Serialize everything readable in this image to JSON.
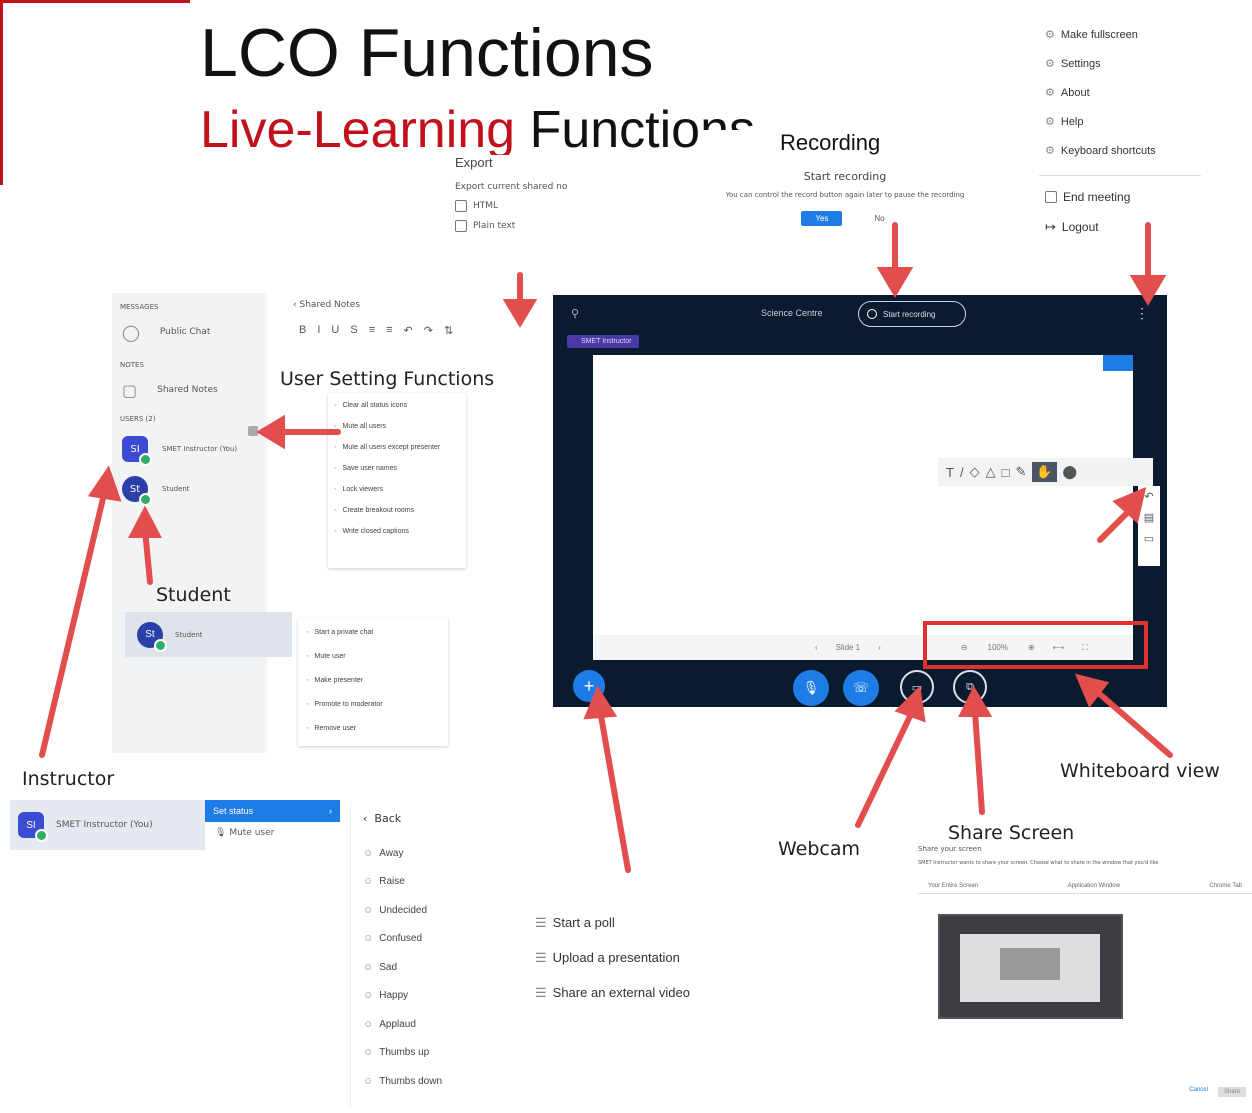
{
  "slide": {
    "title": "LCO Functions",
    "subtitle_red": "Live-Learning",
    "subtitle_black": "Functions"
  },
  "colors": {
    "accent_red": "#c1121c",
    "bbb_dark": "#0b1b2f",
    "bbb_blue": "#1e7ce6",
    "arrow": "#e24d4d"
  },
  "export": {
    "title": "Export",
    "desc": "Export current shared no",
    "opt1": "HTML",
    "opt2": "Plain text"
  },
  "recording": {
    "title": "Recording",
    "subtitle": "Start recording",
    "desc": "You can control the record button again later to pause the recording",
    "yes": "Yes",
    "no": "No"
  },
  "options_menu": {
    "items": [
      "Make fullscreen",
      "Settings",
      "About",
      "Help",
      "Keyboard shortcuts"
    ],
    "end": "End meeting",
    "logout": "Logout"
  },
  "sidebar": {
    "messages_label": "MESSAGES",
    "public_chat": "Public Chat",
    "notes_label": "NOTES",
    "shared_notes": "Shared Notes",
    "users_label": "USERS (2)",
    "instructor": "SMET Instructor (You)",
    "student": "Student"
  },
  "notes_editor": {
    "back": "Shared Notes",
    "tools": [
      "B",
      "I",
      "U",
      "S",
      "≡",
      "≡",
      "↶",
      "↷",
      "⇅"
    ]
  },
  "user_settings": {
    "label": "User Setting Functions",
    "items": [
      "Clear all status icons",
      "Mute all users",
      "Mute all users except presenter",
      "Save user names",
      "Lock viewers",
      "Create breakout rooms",
      "Write closed captions"
    ]
  },
  "student_menu": {
    "label": "Student",
    "name": "Student",
    "items": [
      "Start a private chat",
      "Mute user",
      "Make presenter",
      "Promote to moderator",
      "Remove user"
    ]
  },
  "instructor_menu": {
    "label": "Instructor",
    "name": "SMET Instructor (You)",
    "set_status": "Set status",
    "mute_user": "Mute user",
    "back": "Back",
    "statuses": [
      "Away",
      "Raise",
      "Undecided",
      "Confused",
      "Sad",
      "Happy",
      "Applaud",
      "Thumbs up",
      "Thumbs down"
    ]
  },
  "bbb": {
    "room": "Science Centre",
    "record_btn": "Start recording",
    "presenter": "SMET Instructor",
    "slide_nav": "Slide 1",
    "zoom": "100%"
  },
  "plus_menu": {
    "items": [
      "Start a poll",
      "Upload a presentation",
      "Share an external video"
    ]
  },
  "share": {
    "label": "Share Screen",
    "title": "Share your screen",
    "desc": "SMET Instructor wants to share your screen. Choose what to share in the window that you'd like",
    "tabs": [
      "Your Entire Screen",
      "Application Window",
      "Chrome Tab"
    ],
    "cancel": "Cancel",
    "share_btn": "Share"
  },
  "labels": {
    "webcam": "Webcam",
    "whiteboard": "Whiteboard view"
  }
}
